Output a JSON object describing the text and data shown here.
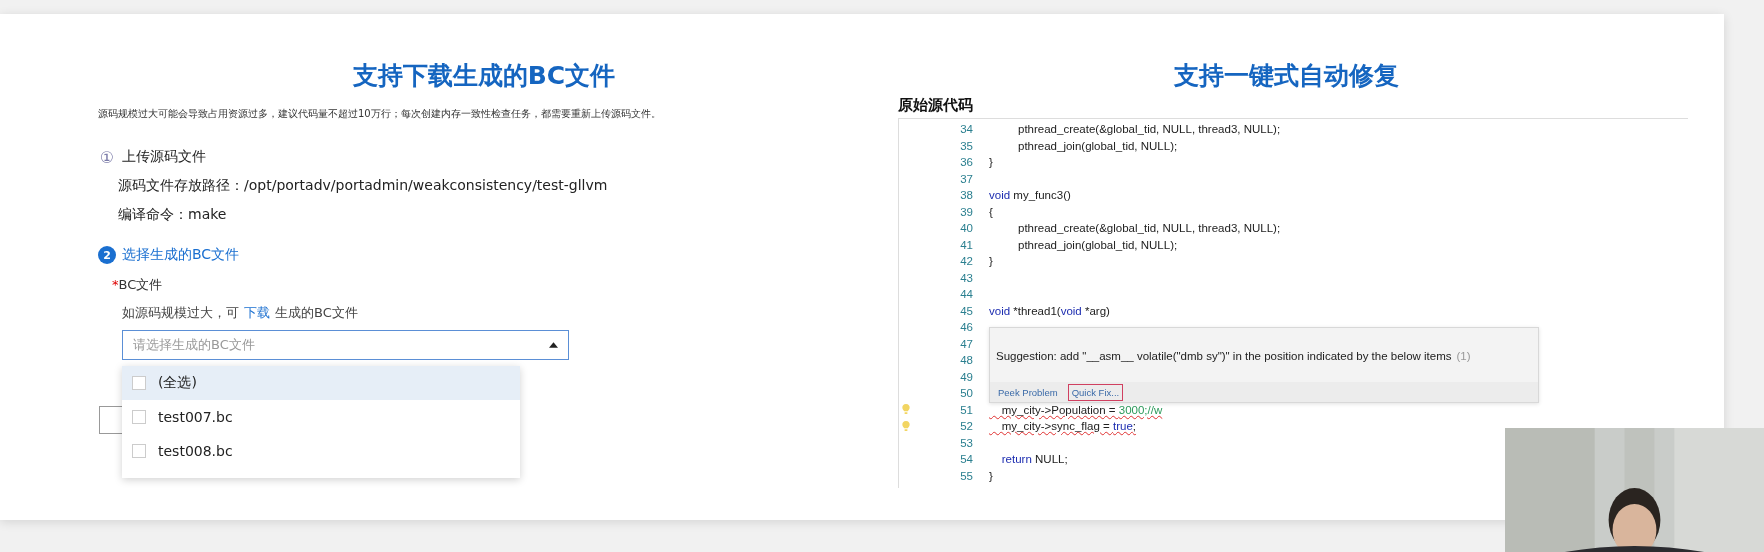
{
  "left": {
    "title": "支持下载生成的BC文件",
    "description": "源码规模过大可能会导致占用资源过多，建议代码量不超过10万行；每次创建内存一致性检查任务，都需要重新上传源码文件。",
    "steps": [
      {
        "number": "①",
        "label": "上传源码文件",
        "active": false,
        "details": [
          "源码文件存放路径：/opt/portadv/portadmin/weakconsistency/test-gllvm",
          "编译命令：make"
        ]
      },
      {
        "number": "2",
        "label": "选择生成的BC文件",
        "active": true
      }
    ],
    "field": {
      "required_mark": "*",
      "label": "BC文件",
      "hint_before": "如源码规模过大，可",
      "hint_link": "下载",
      "hint_after": "生成的BC文件",
      "placeholder": "请选择生成的BC文件",
      "expanded": true,
      "options": [
        {
          "label": "(全选)",
          "checked": false,
          "highlighted": true
        },
        {
          "label": "test007.bc",
          "checked": false,
          "highlighted": false
        },
        {
          "label": "test008.bc",
          "checked": false,
          "highlighted": false
        }
      ]
    }
  },
  "right": {
    "title": "支持一键式自动修复",
    "section_title": "原始源代码",
    "code_lines": [
      {
        "number": "34",
        "segments": [
          {
            "kind": "plain",
            "text": "\tpthread_create(&global_tid, NULL, thread3, NULL);"
          }
        ]
      },
      {
        "number": "35",
        "segments": [
          {
            "kind": "plain",
            "text": "\tpthread_join(global_tid, NULL);"
          }
        ]
      },
      {
        "number": "36",
        "segments": [
          {
            "kind": "plain",
            "text": "}"
          }
        ]
      },
      {
        "number": "37"
      },
      {
        "number": "38",
        "segments": [
          {
            "kind": "keyword",
            "text": "void"
          },
          {
            "kind": "plain",
            "text": " my_func3()"
          }
        ]
      },
      {
        "number": "39",
        "segments": [
          {
            "kind": "plain",
            "text": "{"
          }
        ]
      },
      {
        "number": "40",
        "segments": [
          {
            "kind": "plain",
            "text": "\tpthread_create(&global_tid, NULL, thread3, NULL);"
          }
        ]
      },
      {
        "number": "41",
        "segments": [
          {
            "kind": "plain",
            "text": "\tpthread_join(global_tid, NULL);"
          }
        ]
      },
      {
        "number": "42",
        "segments": [
          {
            "kind": "plain",
            "text": "}"
          }
        ]
      },
      {
        "number": "43"
      },
      {
        "number": "44"
      },
      {
        "number": "45",
        "segments": [
          {
            "kind": "keyword",
            "text": "void"
          },
          {
            "kind": "plain",
            "text": " *thread1("
          },
          {
            "kind": "keyword",
            "text": "void"
          },
          {
            "kind": "plain",
            "text": " *arg)"
          }
        ]
      },
      {
        "number": "46"
      },
      {
        "number": "47"
      },
      {
        "number": "48"
      },
      {
        "number": "49"
      },
      {
        "number": "50"
      },
      {
        "number": "51",
        "error": true,
        "bulb": true,
        "segments": [
          {
            "kind": "plain",
            "text": "    my_city->Population = "
          },
          {
            "kind": "number",
            "text": "3000;//w"
          }
        ]
      },
      {
        "number": "52",
        "error": true,
        "bulb": true,
        "segments": [
          {
            "kind": "plain",
            "text": "    my_city->sync_flag = "
          },
          {
            "kind": "keyword",
            "text": "true"
          },
          {
            "kind": "plain",
            "text": ";"
          }
        ]
      },
      {
        "number": "53"
      },
      {
        "number": "54",
        "segments": [
          {
            "kind": "keyword",
            "text": "    return"
          },
          {
            "kind": "plain",
            "text": " NULL;"
          }
        ]
      },
      {
        "number": "55",
        "segments": [
          {
            "kind": "plain",
            "text": "}"
          }
        ]
      }
    ],
    "popup": {
      "message": "Suggestion: add \"__asm__ volatile(\"dmb sy\")\" in the position indicated by the below items",
      "count": "(1)",
      "actions": [
        {
          "label": "Peek Problem",
          "selected": false
        },
        {
          "label": "Quick Fix...",
          "selected": true
        }
      ]
    }
  }
}
